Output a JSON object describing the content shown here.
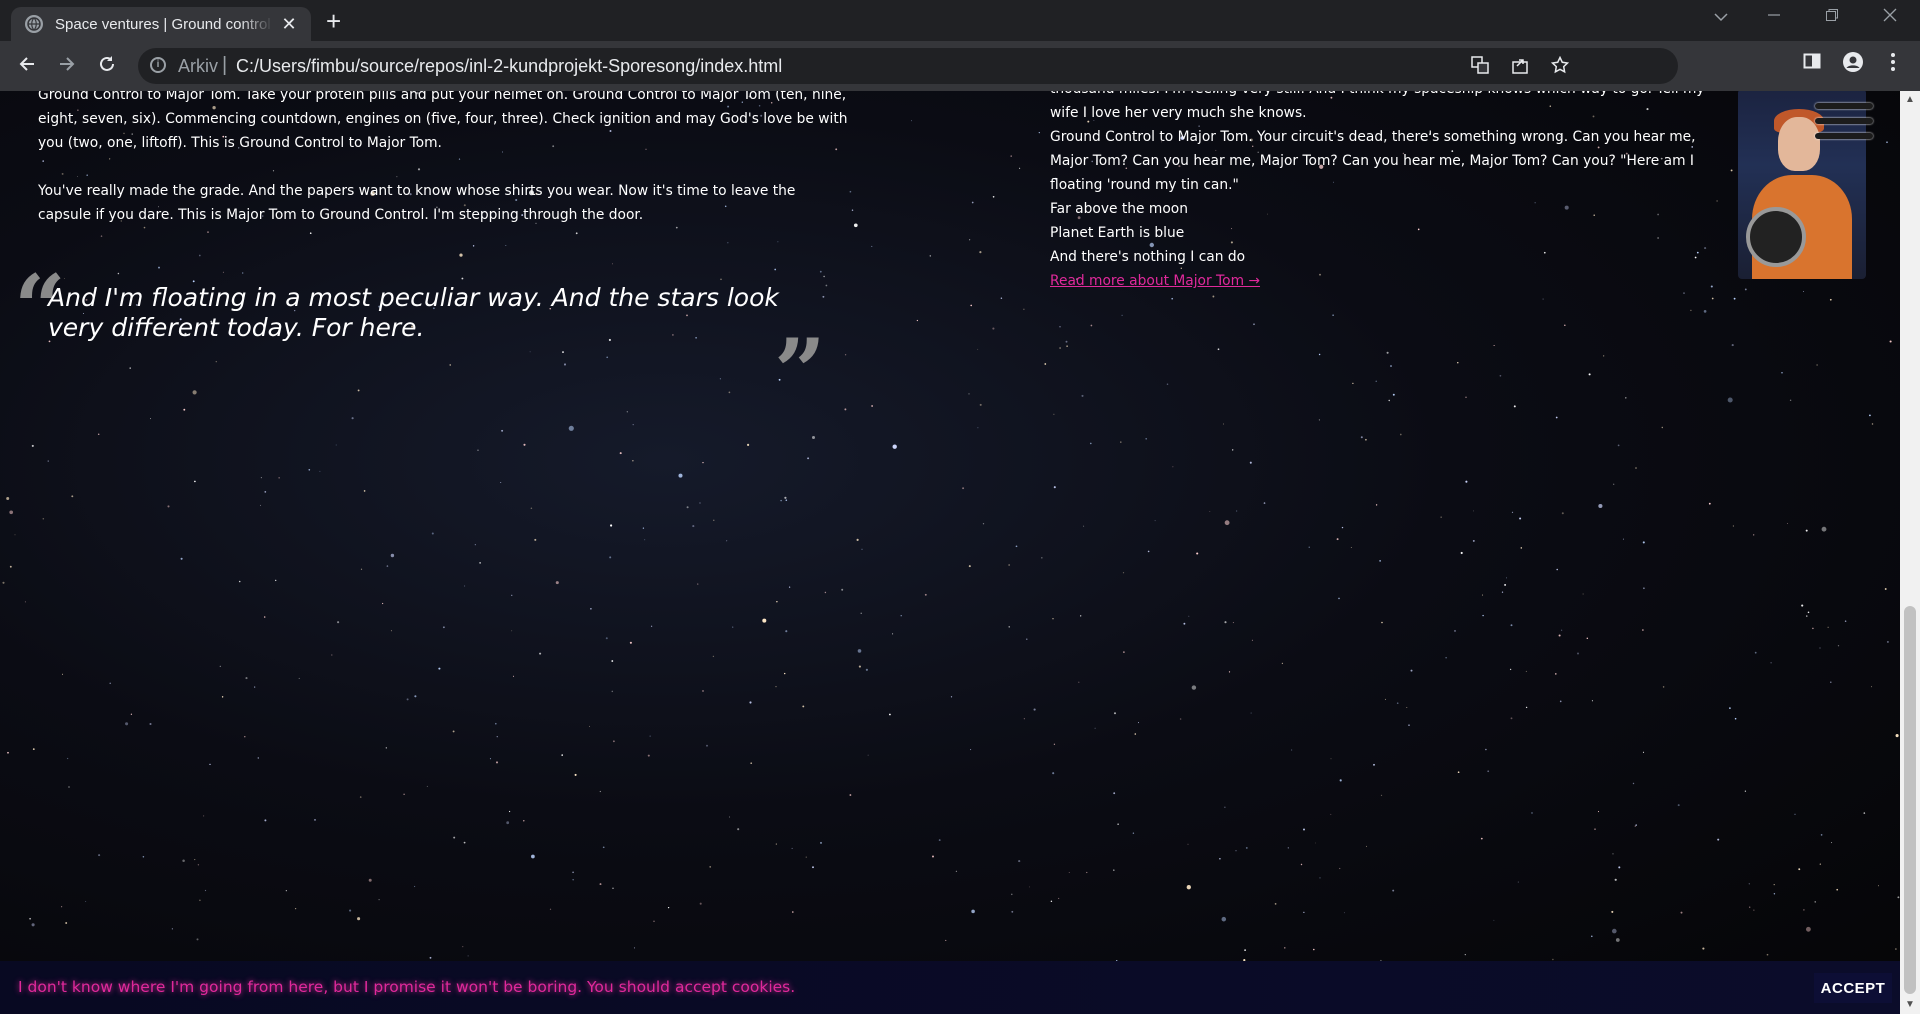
{
  "browser": {
    "tab_title": "Space ventures | Ground control",
    "tab_close": "✕",
    "new_tab": "+",
    "scheme_label": "Arkiv",
    "url": "C:/Users/fimbu/source/repos/inl-2-kundprojekt-Sporesong/index.html"
  },
  "page": {
    "left_paragraphs": [
      "Ground Control to Major Tom. Take your protein pills and put your helmet on. Ground Control to Major Tom (ten, nine, eight, seven, six). Commencing countdown, engines on (five, four, three). Check ignition and may God's love be with you (two, one, liftoff). This is Ground Control to Major Tom.",
      "You've really made the grade. And the papers want to know whose shirts you wear. Now it's time to leave the capsule if you dare. This is Major Tom to Ground Control. I'm stepping through the door."
    ],
    "quote": "And I'm floating in a most peculiar way. And the stars look very different today. For here.",
    "quote_open": "“",
    "quote_close": "”",
    "right_lines": [
      "thousand miles. I'm feeling very still. And I think my spaceship knows which way to go. Tell my wife I love her very much she knows.",
      "Ground Control to Major Tom. Your circuit's dead, there's something wrong. Can you hear me, Major Tom? Can you hear me, Major Tom? Can you hear me, Major Tom? Can you? \"Here am I floating 'round my tin can.\"",
      "Far above the moon",
      "Planet Earth is blue",
      "And there's nothing I can do"
    ],
    "read_more": "Read more about Major Tom  →"
  },
  "cookie": {
    "message": "I don't know where I'm going from here, but I promise it won't be boring. You should accept cookies.",
    "accept_label": "ACCEPT"
  },
  "colors": {
    "accent": "#e0299b",
    "background": "#050507"
  },
  "icons": [
    "globe-icon",
    "close-icon",
    "plus-icon",
    "chevron-down-icon",
    "minimize-icon",
    "restore-icon",
    "window-close-icon",
    "back-icon",
    "forward-icon",
    "reload-icon",
    "info-icon",
    "translate-icon",
    "share-icon",
    "star-icon",
    "side-panel-icon",
    "profile-icon",
    "kebab-menu-icon",
    "hamburger-menu-icon"
  ]
}
